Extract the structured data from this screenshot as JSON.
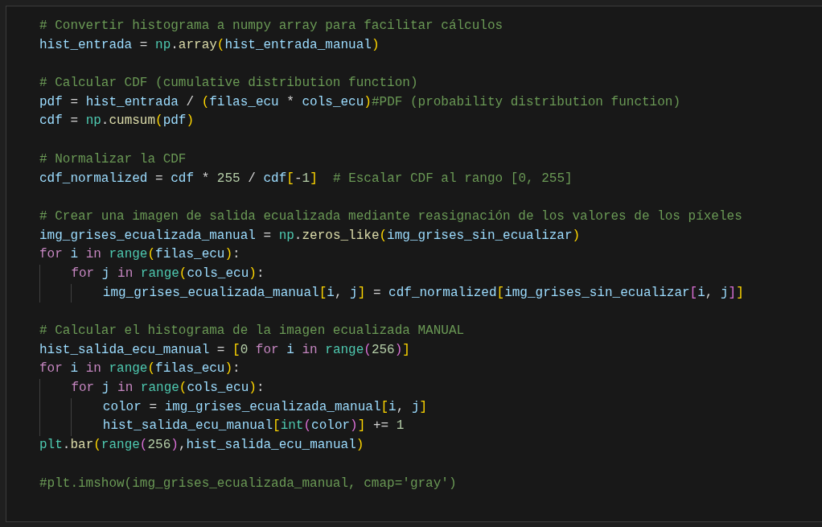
{
  "editor": {
    "blocks": [
      {
        "lines": [
          {
            "tokens": [
              {
                "kind": "comment",
                "text": "# Convertir histograma a numpy array para facilitar cálculos"
              }
            ]
          },
          {
            "tokens": [
              {
                "kind": "var",
                "text": "hist_entrada"
              },
              {
                "kind": "op",
                "text": " = "
              },
              {
                "kind": "module",
                "text": "np"
              },
              {
                "kind": "op",
                "text": "."
              },
              {
                "kind": "func",
                "text": "array"
              },
              {
                "kind": "bracket",
                "text": "(",
                "color": "#ffd700"
              },
              {
                "kind": "var",
                "text": "hist_entrada_manual"
              },
              {
                "kind": "bracket",
                "text": ")",
                "color": "#ffd700"
              }
            ]
          }
        ]
      },
      {
        "lines": [
          {
            "tokens": [
              {
                "kind": "comment",
                "text": "# Calcular CDF (cumulative distribution function)"
              }
            ]
          },
          {
            "tokens": [
              {
                "kind": "var",
                "text": "pdf"
              },
              {
                "kind": "op",
                "text": " = "
              },
              {
                "kind": "var",
                "text": "hist_entrada"
              },
              {
                "kind": "op",
                "text": " / "
              },
              {
                "kind": "bracket",
                "text": "(",
                "color": "#ffd700"
              },
              {
                "kind": "var",
                "text": "filas_ecu"
              },
              {
                "kind": "op",
                "text": " * "
              },
              {
                "kind": "var",
                "text": "cols_ecu"
              },
              {
                "kind": "bracket",
                "text": ")",
                "color": "#ffd700"
              },
              {
                "kind": "comment",
                "text": "#PDF (probability distribution function)"
              }
            ]
          },
          {
            "tokens": [
              {
                "kind": "var",
                "text": "cdf"
              },
              {
                "kind": "op",
                "text": " = "
              },
              {
                "kind": "module",
                "text": "np"
              },
              {
                "kind": "op",
                "text": "."
              },
              {
                "kind": "func",
                "text": "cumsum"
              },
              {
                "kind": "bracket",
                "text": "(",
                "color": "#ffd700"
              },
              {
                "kind": "var",
                "text": "pdf"
              },
              {
                "kind": "bracket",
                "text": ")",
                "color": "#ffd700"
              }
            ]
          }
        ]
      },
      {
        "lines": [
          {
            "tokens": [
              {
                "kind": "comment",
                "text": "# Normalizar la CDF"
              }
            ]
          },
          {
            "tokens": [
              {
                "kind": "var",
                "text": "cdf_normalized"
              },
              {
                "kind": "op",
                "text": " = "
              },
              {
                "kind": "var",
                "text": "cdf"
              },
              {
                "kind": "op",
                "text": " * "
              },
              {
                "kind": "number",
                "text": "255"
              },
              {
                "kind": "op",
                "text": " / "
              },
              {
                "kind": "var",
                "text": "cdf"
              },
              {
                "kind": "bracket",
                "text": "[",
                "color": "#ffd700"
              },
              {
                "kind": "op",
                "text": "-"
              },
              {
                "kind": "number",
                "text": "1"
              },
              {
                "kind": "bracket",
                "text": "]",
                "color": "#ffd700"
              },
              {
                "kind": "comment",
                "text": "  # Escalar CDF al rango [0, 255]"
              }
            ]
          }
        ]
      },
      {
        "lines": [
          {
            "tokens": [
              {
                "kind": "comment",
                "text": "# Crear una imagen de salida ecualizada mediante reasignación de los valores de los píxeles"
              }
            ]
          },
          {
            "tokens": [
              {
                "kind": "var",
                "text": "img_grises_ecualizada_manual"
              },
              {
                "kind": "op",
                "text": " = "
              },
              {
                "kind": "module",
                "text": "np"
              },
              {
                "kind": "op",
                "text": "."
              },
              {
                "kind": "func",
                "text": "zeros_like"
              },
              {
                "kind": "bracket",
                "text": "(",
                "color": "#ffd700"
              },
              {
                "kind": "var",
                "text": "img_grises_sin_ecualizar"
              },
              {
                "kind": "bracket",
                "text": ")",
                "color": "#ffd700"
              }
            ]
          },
          {
            "tokens": [
              {
                "kind": "keyword",
                "text": "for"
              },
              {
                "kind": "var",
                "text": " i "
              },
              {
                "kind": "keyword",
                "text": "in"
              },
              {
                "kind": "module",
                "text": " range"
              },
              {
                "kind": "bracket",
                "text": "(",
                "color": "#ffd700"
              },
              {
                "kind": "var",
                "text": "filas_ecu"
              },
              {
                "kind": "bracket",
                "text": ")",
                "color": "#ffd700"
              },
              {
                "kind": "op",
                "text": ":"
              }
            ],
            "children": [
              {
                "tokens": [
                  {
                    "kind": "keyword",
                    "text": "for"
                  },
                  {
                    "kind": "var",
                    "text": " j "
                  },
                  {
                    "kind": "keyword",
                    "text": "in"
                  },
                  {
                    "kind": "module",
                    "text": " range"
                  },
                  {
                    "kind": "bracket",
                    "text": "(",
                    "color": "#ffd700"
                  },
                  {
                    "kind": "var",
                    "text": "cols_ecu"
                  },
                  {
                    "kind": "bracket",
                    "text": ")",
                    "color": "#ffd700"
                  },
                  {
                    "kind": "op",
                    "text": ":"
                  }
                ],
                "children": [
                  {
                    "tokens": [
                      {
                        "kind": "var",
                        "text": "img_grises_ecualizada_manual"
                      },
                      {
                        "kind": "bracket",
                        "text": "[",
                        "color": "#ffd700"
                      },
                      {
                        "kind": "var",
                        "text": "i"
                      },
                      {
                        "kind": "op",
                        "text": ", "
                      },
                      {
                        "kind": "var",
                        "text": "j"
                      },
                      {
                        "kind": "bracket",
                        "text": "]",
                        "color": "#ffd700"
                      },
                      {
                        "kind": "op",
                        "text": " = "
                      },
                      {
                        "kind": "var",
                        "text": "cdf_normalized"
                      },
                      {
                        "kind": "bracket",
                        "text": "[",
                        "color": "#ffd700"
                      },
                      {
                        "kind": "var",
                        "text": "img_grises_sin_ecualizar"
                      },
                      {
                        "kind": "bracket",
                        "text": "[",
                        "color": "#da70d6"
                      },
                      {
                        "kind": "var",
                        "text": "i"
                      },
                      {
                        "kind": "op",
                        "text": ", "
                      },
                      {
                        "kind": "var",
                        "text": "j"
                      },
                      {
                        "kind": "bracket",
                        "text": "]",
                        "color": "#da70d6"
                      },
                      {
                        "kind": "bracket",
                        "text": "]",
                        "color": "#ffd700"
                      }
                    ]
                  }
                ]
              }
            ]
          }
        ]
      },
      {
        "lines": [
          {
            "tokens": [
              {
                "kind": "comment",
                "text": "# Calcular el histograma de la imagen ecualizada MANUAL"
              }
            ]
          },
          {
            "tokens": [
              {
                "kind": "var",
                "text": "hist_salida_ecu_manual"
              },
              {
                "kind": "op",
                "text": " = "
              },
              {
                "kind": "bracket",
                "text": "[",
                "color": "#ffd700"
              },
              {
                "kind": "number",
                "text": "0"
              },
              {
                "kind": "keyword",
                "text": " for"
              },
              {
                "kind": "var",
                "text": " i "
              },
              {
                "kind": "keyword",
                "text": "in"
              },
              {
                "kind": "module",
                "text": " range"
              },
              {
                "kind": "bracket",
                "text": "(",
                "color": "#da70d6"
              },
              {
                "kind": "number",
                "text": "256"
              },
              {
                "kind": "bracket",
                "text": ")",
                "color": "#da70d6"
              },
              {
                "kind": "bracket",
                "text": "]",
                "color": "#ffd700"
              }
            ]
          },
          {
            "tokens": [
              {
                "kind": "keyword",
                "text": "for"
              },
              {
                "kind": "var",
                "text": " i "
              },
              {
                "kind": "keyword",
                "text": "in"
              },
              {
                "kind": "module",
                "text": " range"
              },
              {
                "kind": "bracket",
                "text": "(",
                "color": "#ffd700"
              },
              {
                "kind": "var",
                "text": "filas_ecu"
              },
              {
                "kind": "bracket",
                "text": ")",
                "color": "#ffd700"
              },
              {
                "kind": "op",
                "text": ":"
              }
            ],
            "children": [
              {
                "tokens": [
                  {
                    "kind": "keyword",
                    "text": "for"
                  },
                  {
                    "kind": "var",
                    "text": " j "
                  },
                  {
                    "kind": "keyword",
                    "text": "in"
                  },
                  {
                    "kind": "module",
                    "text": " range"
                  },
                  {
                    "kind": "bracket",
                    "text": "(",
                    "color": "#ffd700"
                  },
                  {
                    "kind": "var",
                    "text": "cols_ecu"
                  },
                  {
                    "kind": "bracket",
                    "text": ")",
                    "color": "#ffd700"
                  },
                  {
                    "kind": "op",
                    "text": ":"
                  }
                ],
                "children": [
                  {
                    "tokens": [
                      {
                        "kind": "var",
                        "text": "color"
                      },
                      {
                        "kind": "op",
                        "text": " = "
                      },
                      {
                        "kind": "var",
                        "text": "img_grises_ecualizada_manual"
                      },
                      {
                        "kind": "bracket",
                        "text": "[",
                        "color": "#ffd700"
                      },
                      {
                        "kind": "var",
                        "text": "i"
                      },
                      {
                        "kind": "op",
                        "text": ", "
                      },
                      {
                        "kind": "var",
                        "text": "j"
                      },
                      {
                        "kind": "bracket",
                        "text": "]",
                        "color": "#ffd700"
                      }
                    ]
                  },
                  {
                    "tokens": [
                      {
                        "kind": "var",
                        "text": "hist_salida_ecu_manual"
                      },
                      {
                        "kind": "bracket",
                        "text": "[",
                        "color": "#ffd700"
                      },
                      {
                        "kind": "module",
                        "text": "int"
                      },
                      {
                        "kind": "bracket",
                        "text": "(",
                        "color": "#da70d6"
                      },
                      {
                        "kind": "var",
                        "text": "color"
                      },
                      {
                        "kind": "bracket",
                        "text": ")",
                        "color": "#da70d6"
                      },
                      {
                        "kind": "bracket",
                        "text": "]",
                        "color": "#ffd700"
                      },
                      {
                        "kind": "op",
                        "text": " += "
                      },
                      {
                        "kind": "number",
                        "text": "1"
                      }
                    ]
                  }
                ]
              }
            ]
          },
          {
            "tokens": [
              {
                "kind": "module",
                "text": "plt"
              },
              {
                "kind": "op",
                "text": "."
              },
              {
                "kind": "func",
                "text": "bar"
              },
              {
                "kind": "bracket",
                "text": "(",
                "color": "#ffd700"
              },
              {
                "kind": "module",
                "text": "range"
              },
              {
                "kind": "bracket",
                "text": "(",
                "color": "#da70d6"
              },
              {
                "kind": "number",
                "text": "256"
              },
              {
                "kind": "bracket",
                "text": ")",
                "color": "#da70d6"
              },
              {
                "kind": "op",
                "text": ","
              },
              {
                "kind": "var",
                "text": "hist_salida_ecu_manual"
              },
              {
                "kind": "bracket",
                "text": ")",
                "color": "#ffd700"
              }
            ]
          }
        ]
      },
      {
        "lines": [
          {
            "tokens": [
              {
                "kind": "comment",
                "text": "#plt.imshow(img_grises_ecualizada_manual, cmap='gray')"
              }
            ]
          }
        ]
      }
    ]
  }
}
